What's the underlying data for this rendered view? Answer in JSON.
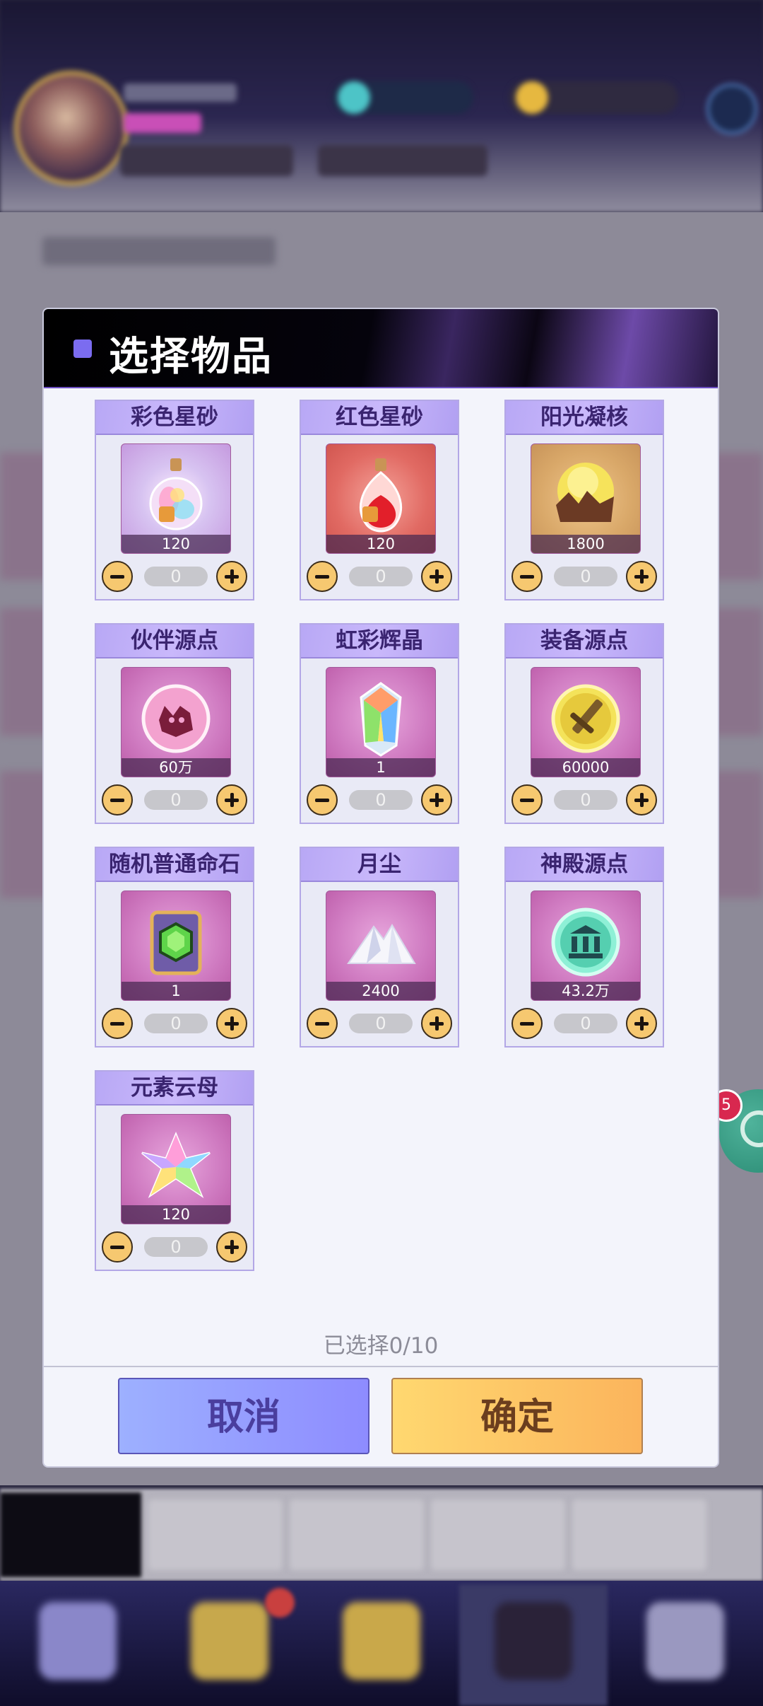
{
  "modal": {
    "title": "选择物品",
    "selected_text": "已选择0/10",
    "cancel_label": "取消",
    "confirm_label": "确定"
  },
  "items": [
    {
      "name": "彩色星砂",
      "count": "120",
      "value": "0",
      "icon": "rainbow-potion-icon"
    },
    {
      "name": "红色星砂",
      "count": "120",
      "value": "0",
      "icon": "red-potion-icon"
    },
    {
      "name": "阳光凝核",
      "count": "1800",
      "value": "0",
      "icon": "sun-core-icon"
    },
    {
      "name": "伙伴源点",
      "count": "60万",
      "value": "0",
      "icon": "partner-orb-icon"
    },
    {
      "name": "虹彩辉晶",
      "count": "1",
      "value": "0",
      "icon": "rainbow-crystal-icon"
    },
    {
      "name": "装备源点",
      "count": "60000",
      "value": "0",
      "icon": "equipment-orb-icon"
    },
    {
      "name": "随机普通命石",
      "count": "1",
      "value": "0",
      "icon": "fate-stone-icon"
    },
    {
      "name": "月尘",
      "count": "2400",
      "value": "0",
      "icon": "moon-dust-icon"
    },
    {
      "name": "神殿源点",
      "count": "43.2万",
      "value": "0",
      "icon": "temple-orb-icon"
    },
    {
      "name": "元素云母",
      "count": "120",
      "value": "0",
      "icon": "element-mica-icon"
    }
  ],
  "floating_badge": "5",
  "colors": {
    "header_bg": "#000000",
    "accent_square": "#7b6cf0",
    "card_title_bg": "#c0b0f8",
    "stepper_button": "#f6c870",
    "cancel_button": "#9db0ff",
    "confirm_button": "#fbc864"
  }
}
